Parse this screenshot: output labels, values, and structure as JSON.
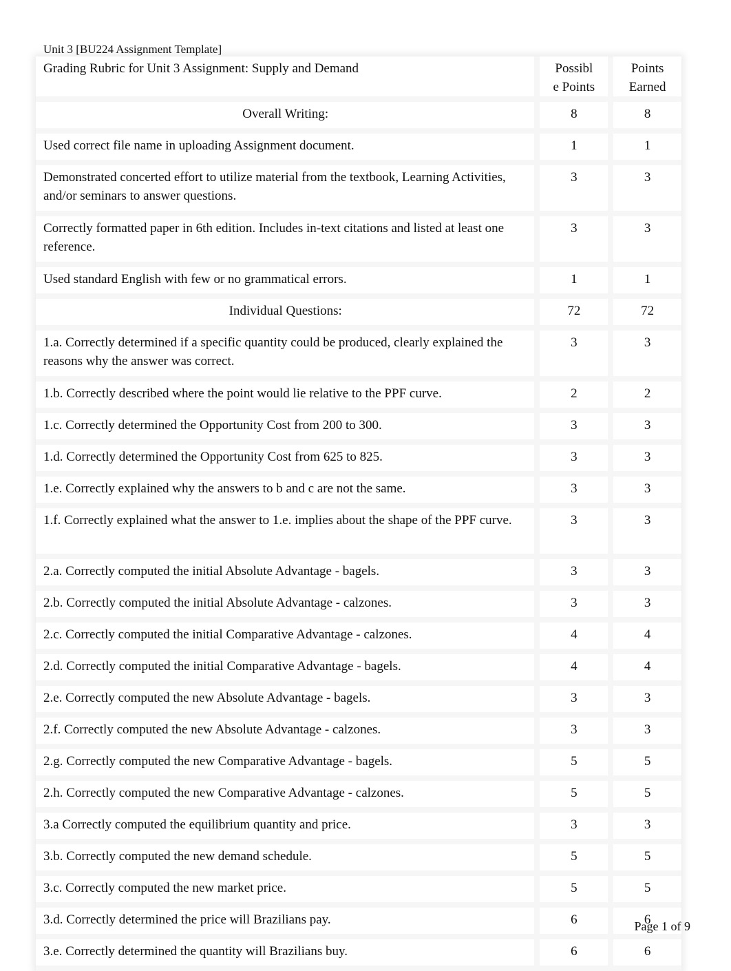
{
  "document": {
    "running_header": "Unit 3 [BU224 Assignment Template]",
    "page_number": "Page 1 of 9"
  },
  "table": {
    "title": "Grading Rubric for Unit 3 Assignment: Supply and Demand",
    "col_possible": "Possibl\ne Points",
    "col_earned": "Points\nEarned",
    "rows": [
      {
        "label": "Overall Writing:",
        "possible": "8",
        "earned": "8",
        "section": true
      },
      {
        "label": "Used correct file name in uploading Assignment document.",
        "possible": "1",
        "earned": "1"
      },
      {
        "label": "Demonstrated concerted effort to utilize material from the textbook, Learning Activities, and/or seminars to answer questions.",
        "possible": "3",
        "earned": "3"
      },
      {
        "label": "Correctly formatted paper in 6th edition. Includes in-text citations and listed at least one reference.",
        "possible": "3",
        "earned": "3"
      },
      {
        "label": "Used standard English with few or no grammatical errors.",
        "possible": "1",
        "earned": "1"
      },
      {
        "label": "Individual Questions:",
        "possible": "72",
        "earned": "72",
        "section": true
      },
      {
        "label": "1.a. Correctly determined if a specific quantity could be produced, clearly explained the reasons why the answer was correct.",
        "possible": "3",
        "earned": "3"
      },
      {
        "label": "1.b. Correctly described where the point would lie relative to the PPF curve.",
        "possible": "2",
        "earned": "2"
      },
      {
        "label": "1.c. Correctly determined the Opportunity Cost from 200 to 300.",
        "possible": "3",
        "earned": "3"
      },
      {
        "label": "1.d. Correctly determined the Opportunity Cost from 625 to 825.",
        "possible": "3",
        "earned": "3"
      },
      {
        "label": "1.e. Correctly explained why the answers to b and c are not the same.",
        "possible": "3",
        "earned": "3"
      },
      {
        "label": "1.f. Correctly explained what the answer to 1.e. implies about the shape of the PPF curve.",
        "possible": "3",
        "earned": "3"
      },
      {
        "label": "2.a. Correctly computed the initial Absolute Advantage - bagels.",
        "possible": "3",
        "earned": "3"
      },
      {
        "label": "2.b. Correctly computed the initial Absolute Advantage - calzones.",
        "possible": "3",
        "earned": "3"
      },
      {
        "label": "2.c. Correctly computed the initial Comparative Advantage - calzones.",
        "possible": "4",
        "earned": "4"
      },
      {
        "label": "2.d. Correctly computed the initial Comparative Advantage - bagels.",
        "possible": "4",
        "earned": "4"
      },
      {
        "label": "2.e. Correctly computed the new Absolute Advantage - bagels.",
        "possible": "3",
        "earned": "3"
      },
      {
        "label": "2.f. Correctly computed the new Absolute Advantage - calzones.",
        "possible": "3",
        "earned": "3"
      },
      {
        "label": "2.g. Correctly computed the new Comparative Advantage - bagels.",
        "possible": "5",
        "earned": "5"
      },
      {
        "label": "2.h. Correctly computed the new Comparative Advantage - calzones.",
        "possible": "5",
        "earned": "5"
      },
      {
        "label": "3.a Correctly computed the equilibrium quantity and price.",
        "possible": "3",
        "earned": "3"
      },
      {
        "label": "3.b. Correctly computed the new demand schedule.",
        "possible": "5",
        "earned": "5"
      },
      {
        "label": "3.c. Correctly computed the new market price.",
        "possible": "5",
        "earned": "5"
      },
      {
        "label": "3.d. Correctly determined the price will Brazilians pay.",
        "possible": "6",
        "earned": "6"
      },
      {
        "label": "3.e. Correctly determined the quantity will Brazilians buy.",
        "possible": "6",
        "earned": "6"
      }
    ]
  }
}
